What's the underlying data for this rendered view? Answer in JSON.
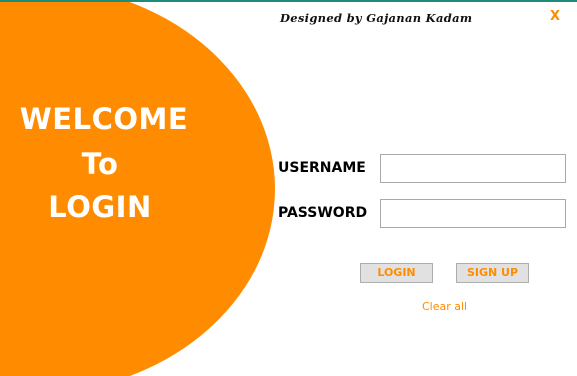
{
  "window": {
    "credit": "Designed by Gajanan Kadam",
    "close_label": "X"
  },
  "welcome": {
    "line1": "WELCOME",
    "line2": "To",
    "line3": "LOGIN"
  },
  "form": {
    "username_label": "USERNAME",
    "username_value": "",
    "password_label": "PASSWORD",
    "password_value": ""
  },
  "buttons": {
    "login_label": "LOGIN",
    "signup_label": "SIGN UP",
    "clear_label": "Clear all"
  },
  "colors": {
    "accent": "#ff8c00",
    "title_bar_border": "#1e8c7d"
  }
}
